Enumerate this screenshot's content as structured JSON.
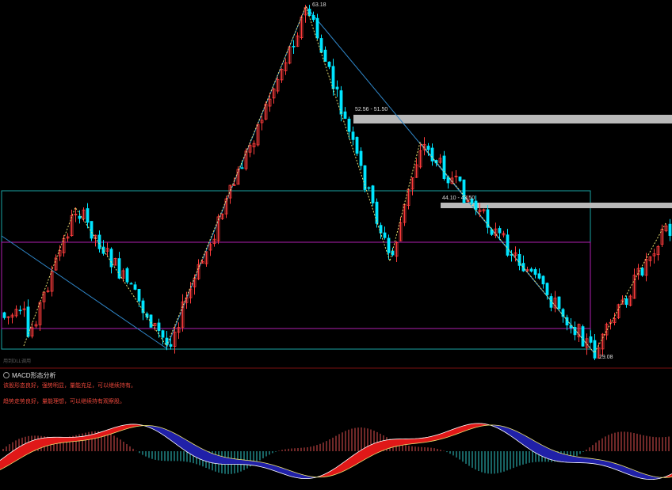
{
  "price_labels": {
    "high": "63.18",
    "low": "29.08",
    "zone_upper": "52.56 - 51.50",
    "zone_lower": "44.10 - 43.50"
  },
  "tool_hint": "用到DLL调用",
  "macd_panel": {
    "title": "MACD形态分析",
    "lines": [
      "该股形态良好，强势明显，量能充足，可以继续持有。",
      "趋势走势良好，量能理想，可以继续持有观察股。"
    ]
  },
  "colors": {
    "background": "#000000",
    "up_candle": "#ff3c3c",
    "down_candle": "#00e5ff",
    "trend_line": "#2f86c8",
    "zigzag": "#e8e070",
    "channel_outer": "#1aa5a5",
    "channel_inner": "#b020b0",
    "zone_bar": "#b9b9b9",
    "macd_pos": "#e01818",
    "macd_neg": "#2020a8",
    "histogram_pos": "#e05050",
    "histogram_neg": "#30c8c8",
    "divider": "#7a1010"
  }
}
